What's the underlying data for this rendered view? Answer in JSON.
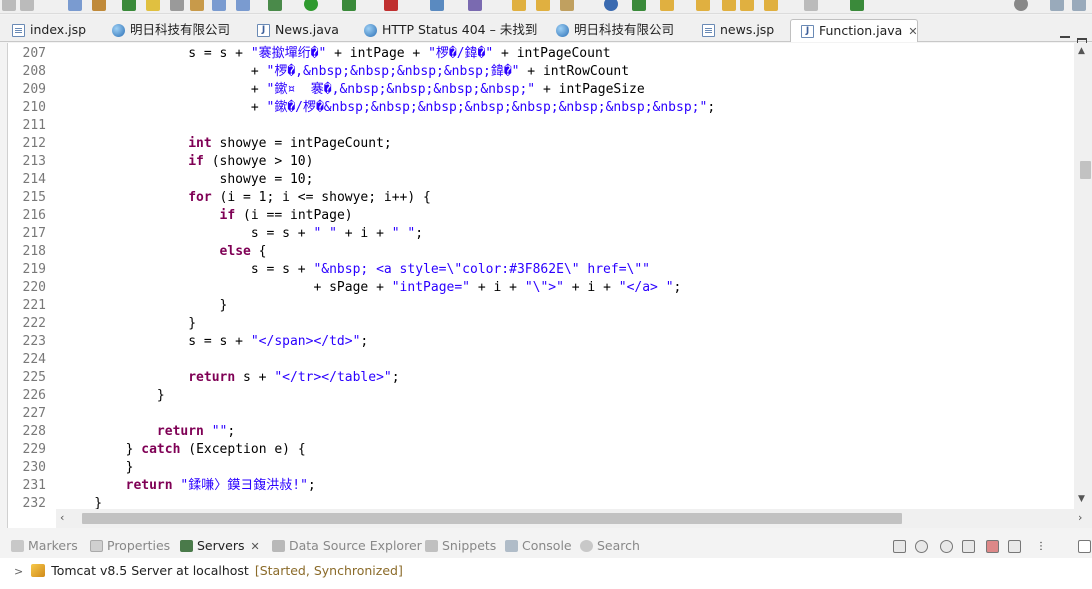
{
  "editor_tabs": [
    {
      "label": "index.jsp",
      "icon": "jsp-file-icon",
      "active": false
    },
    {
      "label": "明日科技有限公司",
      "icon": "browser-globe-icon",
      "active": false
    },
    {
      "label": "News.java",
      "icon": "java-file-icon",
      "active": false
    },
    {
      "label": "HTTP Status 404 – 未找到",
      "icon": "browser-globe-icon",
      "active": false
    },
    {
      "label": "明日科技有限公司",
      "icon": "browser-globe-icon",
      "active": false
    },
    {
      "label": "news.jsp",
      "icon": "jsp-file-icon",
      "active": false
    },
    {
      "label": "Function.java",
      "icon": "java-file-icon",
      "active": true,
      "close": "✕"
    }
  ],
  "code_lines": [
    {
      "n": "207",
      "segs": [
        [
          "p",
          "                s = s + "
        ],
        [
          "s",
          "\"褰撳墠绗�\""
        ],
        [
          "p",
          " + intPage + "
        ],
        [
          "s",
          "\"椤�/鍏�\""
        ],
        [
          "p",
          " + intPageCount"
        ]
      ]
    },
    {
      "n": "208",
      "segs": [
        [
          "p",
          "                        + "
        ],
        [
          "s",
          "\"椤�,&nbsp;&nbsp;&nbsp;&nbsp;鍏�\""
        ],
        [
          "p",
          " + intRowCount"
        ]
      ]
    },
    {
      "n": "209",
      "segs": [
        [
          "p",
          "                        + "
        ],
        [
          "s",
          "\"鏉¤  褰�,&nbsp;&nbsp;&nbsp;&nbsp;\""
        ],
        [
          "p",
          " + intPageSize"
        ]
      ]
    },
    {
      "n": "210",
      "segs": [
        [
          "p",
          "                        + "
        ],
        [
          "s",
          "\"鏉�/椤�&nbsp;&nbsp;&nbsp;&nbsp;&nbsp;&nbsp;&nbsp;&nbsp;\""
        ],
        [
          "p",
          ";"
        ]
      ]
    },
    {
      "n": "211",
      "segs": []
    },
    {
      "n": "212",
      "segs": [
        [
          "p",
          "                "
        ],
        [
          "k",
          "int"
        ],
        [
          "p",
          " showye = intPageCount;"
        ]
      ]
    },
    {
      "n": "213",
      "segs": [
        [
          "p",
          "                "
        ],
        [
          "k",
          "if"
        ],
        [
          "p",
          " (showye > 10)"
        ]
      ]
    },
    {
      "n": "214",
      "segs": [
        [
          "p",
          "                    showye = 10;"
        ]
      ]
    },
    {
      "n": "215",
      "segs": [
        [
          "p",
          "                "
        ],
        [
          "k",
          "for"
        ],
        [
          "p",
          " (i = 1; i <= showye; i++) {"
        ]
      ]
    },
    {
      "n": "216",
      "segs": [
        [
          "p",
          "                    "
        ],
        [
          "k",
          "if"
        ],
        [
          "p",
          " (i == intPage)"
        ]
      ]
    },
    {
      "n": "217",
      "segs": [
        [
          "p",
          "                        s = s + "
        ],
        [
          "s",
          "\" \""
        ],
        [
          "p",
          " + i + "
        ],
        [
          "s",
          "\" \""
        ],
        [
          "p",
          ";"
        ]
      ]
    },
    {
      "n": "218",
      "segs": [
        [
          "p",
          "                    "
        ],
        [
          "k",
          "else"
        ],
        [
          "p",
          " {"
        ]
      ]
    },
    {
      "n": "219",
      "segs": [
        [
          "p",
          "                        s = s + "
        ],
        [
          "s",
          "\"&nbsp; <a style=\\\"color:#3F862E\\\" href=\\\"\""
        ]
      ]
    },
    {
      "n": "220",
      "segs": [
        [
          "p",
          "                                + sPage + "
        ],
        [
          "s",
          "\"intPage=\""
        ],
        [
          "p",
          " + i + "
        ],
        [
          "s",
          "\"\\\">\""
        ],
        [
          "p",
          " + i + "
        ],
        [
          "s",
          "\"</a> \""
        ],
        [
          "p",
          ";"
        ]
      ]
    },
    {
      "n": "221",
      "segs": [
        [
          "p",
          "                    }"
        ]
      ]
    },
    {
      "n": "222",
      "segs": [
        [
          "p",
          "                }"
        ]
      ]
    },
    {
      "n": "223",
      "segs": [
        [
          "p",
          "                s = s + "
        ],
        [
          "s",
          "\"</span></td>\""
        ],
        [
          "p",
          ";"
        ]
      ]
    },
    {
      "n": "224",
      "segs": []
    },
    {
      "n": "225",
      "segs": [
        [
          "p",
          "                "
        ],
        [
          "k",
          "return"
        ],
        [
          "p",
          " s + "
        ],
        [
          "s",
          "\"</tr></table>\""
        ],
        [
          "p",
          ";"
        ]
      ]
    },
    {
      "n": "226",
      "segs": [
        [
          "p",
          "            }"
        ]
      ]
    },
    {
      "n": "227",
      "segs": []
    },
    {
      "n": "228",
      "segs": [
        [
          "p",
          "            "
        ],
        [
          "k",
          "return"
        ],
        [
          "p",
          " "
        ],
        [
          "s",
          "\"\""
        ],
        [
          "p",
          ";"
        ]
      ]
    },
    {
      "n": "229",
      "segs": [
        [
          "p",
          "        } "
        ],
        [
          "k",
          "catch"
        ],
        [
          "p",
          " (Exception e) {"
        ]
      ]
    },
    {
      "n": "230",
      "segs": [
        [
          "p",
          "        }"
        ]
      ]
    },
    {
      "n": "231",
      "segs": [
        [
          "p",
          "        "
        ],
        [
          "k",
          "return"
        ],
        [
          "p",
          " "
        ],
        [
          "s",
          "\"鍒嗛〉鏌ヨ鍑洪敊!\""
        ],
        [
          "p",
          ";"
        ]
      ]
    },
    {
      "n": "232",
      "segs": [
        [
          "p",
          "    }"
        ]
      ]
    }
  ],
  "panel_tabs": [
    {
      "label": "Markers",
      "icon": "markers-icon",
      "active": false
    },
    {
      "label": "Properties",
      "icon": "properties-icon",
      "active": false
    },
    {
      "label": "Servers",
      "icon": "servers-icon",
      "active": true,
      "close": "✕"
    },
    {
      "label": "Data Source Explorer",
      "icon": "data-source-icon",
      "active": false
    },
    {
      "label": "Snippets",
      "icon": "snippets-icon",
      "active": false
    },
    {
      "label": "Console",
      "icon": "console-icon",
      "active": false
    },
    {
      "label": "Search",
      "icon": "search-icon",
      "active": false
    }
  ],
  "server": {
    "name": "Tomcat v8.5 Server at localhost",
    "state": "[Started, Synchronized]"
  },
  "colors": {
    "keyword": "#7f0055",
    "string": "#2a00ff",
    "line_number": "#787878"
  }
}
